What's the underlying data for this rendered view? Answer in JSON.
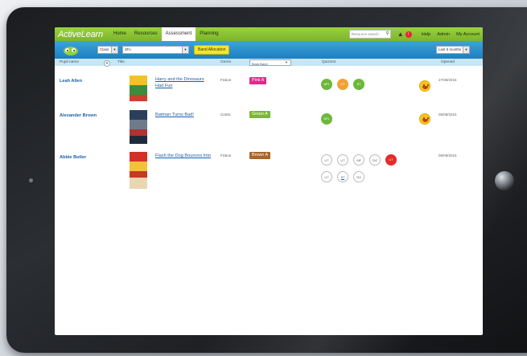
{
  "app": {
    "brand": "ActiveLearn"
  },
  "nav": {
    "items": [
      {
        "label": "Home"
      },
      {
        "label": "Resources"
      },
      {
        "label": "Assessment",
        "active": true
      },
      {
        "label": "Planning"
      }
    ],
    "search_placeholder": "Resource search",
    "alert_count": "!",
    "help": "Help",
    "admin": "Admin",
    "my_account": "My Account"
  },
  "toolbar": {
    "class_select": "Class",
    "group_select": "3Fo",
    "band_allocation_button": "Band Allocation",
    "period_select": "Last 5 months"
  },
  "columns": {
    "pupil_name": "Pupil name",
    "title": "Title",
    "genre": "Genre",
    "book_band": "Book Band",
    "quizzes": "Quizzes",
    "opened": "Opened"
  },
  "colors": {
    "nav_green": "#8cc63f",
    "toolbar_blue": "#2b8fd0",
    "band_pink": "#e0298c",
    "band_green": "#7ab82e",
    "band_brown": "#a9652b",
    "quiz_green": "#6cb83a",
    "quiz_orange": "#f1a134",
    "quiz_red": "#e42b2b"
  },
  "rows": [
    {
      "pupil": "Leah Allen",
      "title": "Harry and the Dinosaurs Had Fun",
      "genre": "Fiction",
      "band": "Pink A",
      "quizzes": [
        {
          "label": "WPL",
          "state": "green"
        },
        {
          "label": "LIT",
          "state": "orange"
        },
        {
          "label": "BT",
          "state": "green"
        }
      ],
      "mood_icon": "smiley-icon",
      "opened": "27/08/2015"
    },
    {
      "pupil": "Alexander Brown",
      "title": "Batman Turns Bad!",
      "genre": "Comic",
      "band": "Green A",
      "quizzes": [
        {
          "label": "WPL",
          "state": "green"
        }
      ],
      "mood_icon": "smiley-icon",
      "opened": "06/08/2015"
    },
    {
      "pupil": "Abbie Butler",
      "title": "Flash the Dog Bounces Into",
      "genre": "Fiction",
      "band": "Brown A",
      "quizzes": [
        {
          "label": "LIT",
          "state": "empty"
        },
        {
          "label": "LIT",
          "state": "empty"
        },
        {
          "label": "INF",
          "state": "empty"
        },
        {
          "label": "TAC",
          "state": "empty"
        },
        {
          "label": "LIT",
          "state": "red"
        },
        {
          "label": "LIT",
          "state": "empty"
        },
        {
          "label": "BT",
          "state": "link"
        },
        {
          "label": "TAC",
          "state": "empty"
        }
      ],
      "opened": "06/09/2015"
    }
  ]
}
